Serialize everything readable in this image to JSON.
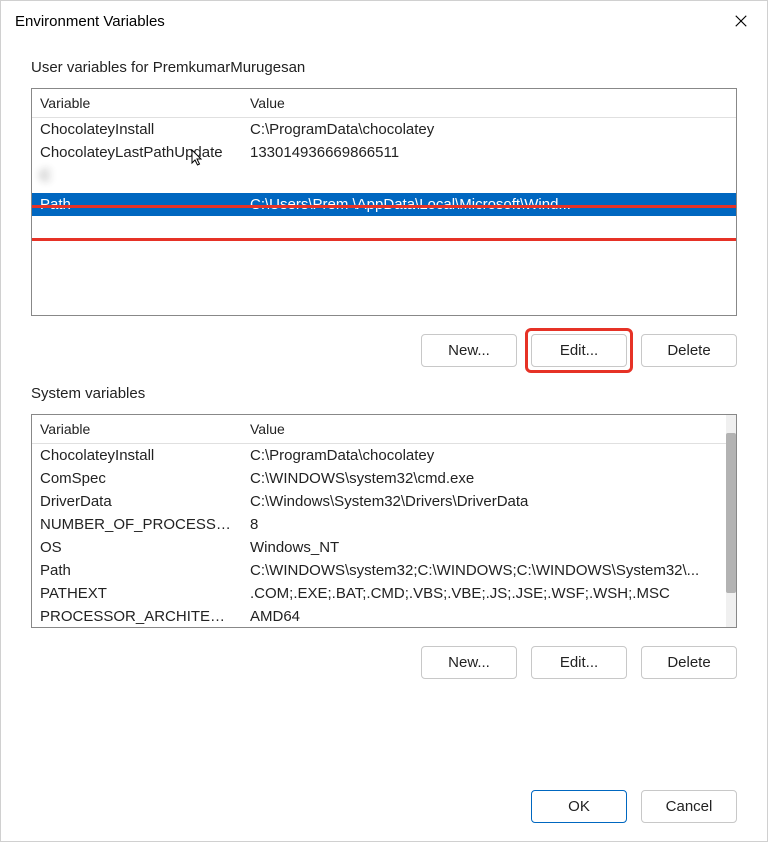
{
  "window": {
    "title": "Environment Variables"
  },
  "userSection": {
    "label": "User variables for PremkumarMurugesan",
    "headers": {
      "variable": "Variable",
      "value": "Value"
    },
    "rows": [
      {
        "variable": "ChocolateyInstall",
        "value": "C:\\ProgramData\\chocolatey",
        "blurred": false,
        "selected": false
      },
      {
        "variable": "ChocolateyLastPathUpdate",
        "value": "133014936669866511",
        "blurred": false,
        "selected": false
      },
      {
        "variable": "C",
        "value": " ",
        "blurred": true,
        "selected": false
      },
      {
        "variable": " ",
        "value": " ",
        "blurred": true,
        "selected": false
      },
      {
        "variable": "Path",
        "value": "C:\\Users\\Prem                             \\AppData\\Local\\Microsoft\\Wind...",
        "blurred": false,
        "selected": true
      },
      {
        "variable": " ",
        "value": " ",
        "blurred": true,
        "selected": false
      },
      {
        "variable": " ",
        "value": " ",
        "blurred": true,
        "selected": false
      }
    ],
    "buttons": {
      "new": "New...",
      "edit": "Edit...",
      "delete": "Delete"
    }
  },
  "systemSection": {
    "label": "System variables",
    "headers": {
      "variable": "Variable",
      "value": "Value"
    },
    "rows": [
      {
        "variable": "ChocolateyInstall",
        "value": "C:\\ProgramData\\chocolatey"
      },
      {
        "variable": "ComSpec",
        "value": "C:\\WINDOWS\\system32\\cmd.exe"
      },
      {
        "variable": "DriverData",
        "value": "C:\\Windows\\System32\\Drivers\\DriverData"
      },
      {
        "variable": "NUMBER_OF_PROCESSORS",
        "value": "8"
      },
      {
        "variable": "OS",
        "value": "Windows_NT"
      },
      {
        "variable": "Path",
        "value": "C:\\WINDOWS\\system32;C:\\WINDOWS;C:\\WINDOWS\\System32\\..."
      },
      {
        "variable": "PATHEXT",
        "value": ".COM;.EXE;.BAT;.CMD;.VBS;.VBE;.JS;.JSE;.WSF;.WSH;.MSC"
      },
      {
        "variable": "PROCESSOR_ARCHITECTURE",
        "value": "AMD64"
      }
    ],
    "buttons": {
      "new": "New...",
      "edit": "Edit...",
      "delete": "Delete"
    }
  },
  "footer": {
    "ok": "OK",
    "cancel": "Cancel"
  }
}
